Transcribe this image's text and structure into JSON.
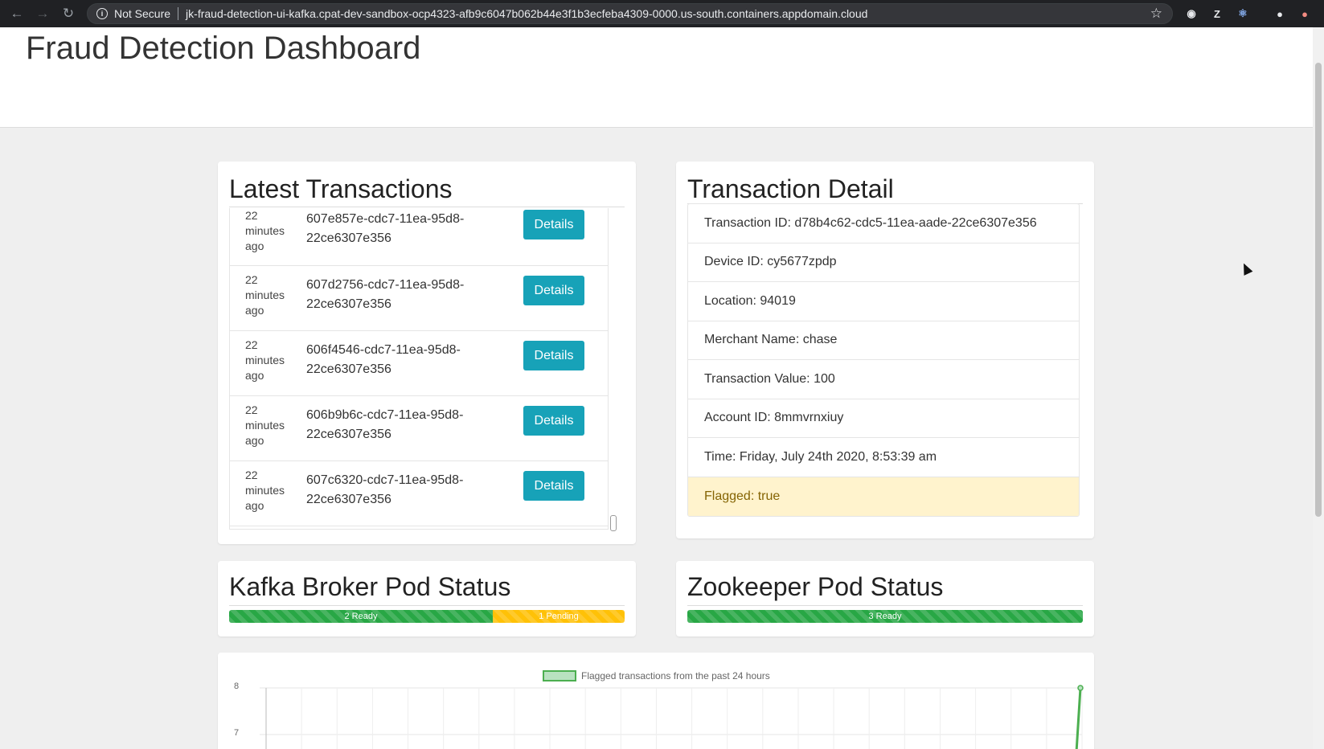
{
  "browser": {
    "security_label": "Not Secure",
    "url": "jk-fraud-detection-ui-kafka.cpat-dev-sandbox-ocp4323-afb9c6047b062b44e3f1b3ecfeba4309-0000.us-south.containers.appdomain.cloud",
    "extension_letter": "Z"
  },
  "page": {
    "title": "Fraud Detection Dashboard"
  },
  "latest_transactions": {
    "title": "Latest Transactions",
    "button_label": "Details",
    "rows": [
      {
        "time": "22 minutes ago",
        "id": "607e857e-cdc7-11ea-95d8-22ce6307e356"
      },
      {
        "time": "22 minutes ago",
        "id": "607d2756-cdc7-11ea-95d8-22ce6307e356"
      },
      {
        "time": "22 minutes ago",
        "id": "606f4546-cdc7-11ea-95d8-22ce6307e356"
      },
      {
        "time": "22 minutes ago",
        "id": "606b9b6c-cdc7-11ea-95d8-22ce6307e356"
      },
      {
        "time": "22 minutes ago",
        "id": "607c6320-cdc7-11ea-95d8-22ce6307e356"
      }
    ]
  },
  "transaction_detail": {
    "title": "Transaction Detail",
    "items": [
      "Transaction ID: d78b4c62-cdc5-11ea-aade-22ce6307e356",
      "Device ID: cy5677zpdp",
      "Location: 94019",
      "Merchant Name: chase",
      "Transaction Value: 100",
      "Account ID: 8mmvrnxiuy",
      "Time: Friday, July 24th 2020, 8:53:39 am"
    ],
    "flagged": "Flagged: true"
  },
  "kafka_status": {
    "title": "Kafka Broker Pod Status",
    "ready_label": "2 Ready",
    "pending_label": "1 Pending",
    "ready_count": 2,
    "pending_count": 1
  },
  "zookeeper_status": {
    "title": "Zookeeper Pod Status",
    "ready_label": "3 Ready",
    "ready_count": 3
  },
  "colors": {
    "accent": "#17a2b8",
    "ready": "#28a745",
    "pending": "#ffc107",
    "flagged_bg": "#fff3cd"
  },
  "chart_data": {
    "type": "line",
    "legend": "Flagged transactions from the past 24 hours",
    "y_ticks": [
      "8",
      "7"
    ],
    "series": [
      {
        "name": "Flagged transactions from the past 24 hours",
        "values": [
          8
        ]
      }
    ]
  }
}
